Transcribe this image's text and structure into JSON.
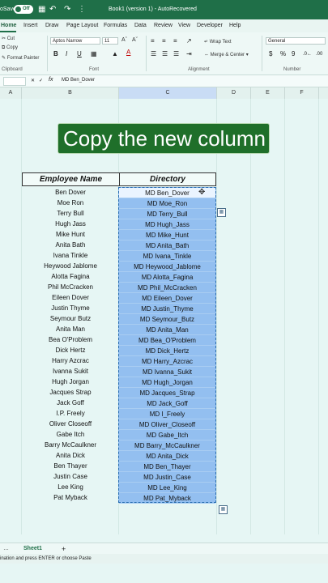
{
  "titlebar": {
    "autosave_prefix": "oSave",
    "toggle_state": "Off",
    "filename": "Book1 (version 1)  -  AutoRecovered",
    "icons": [
      "save-icon",
      "undo-icon",
      "redo-icon",
      "more-icon"
    ]
  },
  "menu": {
    "tabs": [
      "Home",
      "Insert",
      "Draw",
      "Page Layout",
      "Formulas",
      "Data",
      "Review",
      "View",
      "Developer",
      "Help"
    ],
    "active": "Home"
  },
  "ribbon": {
    "clipboard": {
      "cut": "Cut",
      "copy": "Copy",
      "format_painter": "Format Painter",
      "label": "Clipboard"
    },
    "font": {
      "name": "Aptos Narrow",
      "size": "11",
      "bold": "B",
      "italic": "I",
      "underline": "U",
      "label": "Font",
      "font_color": "#c00000"
    },
    "alignment": {
      "wrap_text": "Wrap Text",
      "merge_center": "Merge & Center",
      "label": "Alignment"
    },
    "number": {
      "format": "General",
      "currency": "$",
      "percent": "%",
      "comma": "9",
      "label": "Number"
    }
  },
  "formula_bar": {
    "fx": "fx",
    "content": "MD Ben_Dover"
  },
  "columns": [
    "A",
    "B",
    "C",
    "D",
    "E",
    "F"
  ],
  "banner": {
    "text": "Copy the new column",
    "color": "#1f6f2a"
  },
  "table": {
    "headers": {
      "name": "Employee Name",
      "directory": "Directory"
    },
    "rows": [
      {
        "name": "Ben Dover",
        "directory": "MD Ben_Dover"
      },
      {
        "name": "Moe Ron",
        "directory": "MD Moe_Ron"
      },
      {
        "name": "Terry Bull",
        "directory": "MD Terry_Bull"
      },
      {
        "name": "Hugh Jass",
        "directory": "MD Hugh_Jass"
      },
      {
        "name": "Mike Hunt",
        "directory": "MD Mike_Hunt"
      },
      {
        "name": "Anita Bath",
        "directory": "MD Anita_Bath"
      },
      {
        "name": "Ivana Tinkle",
        "directory": "MD Ivana_Tinkle"
      },
      {
        "name": "Heywood Jablome",
        "directory": "MD Heywood_Jablome"
      },
      {
        "name": "Alotta Fagina",
        "directory": "MD Alotta_Fagina"
      },
      {
        "name": "Phil McCracken",
        "directory": "MD Phil_McCracken"
      },
      {
        "name": "Eileen Dover",
        "directory": "MD Eileen_Dover"
      },
      {
        "name": "Justin Thyme",
        "directory": "MD Justin_Thyme"
      },
      {
        "name": "Seymour Butz",
        "directory": "MD Seymour_Butz"
      },
      {
        "name": "Anita Man",
        "directory": "MD Anita_Man"
      },
      {
        "name": "Bea O'Problem",
        "directory": "MD Bea_O'Problem"
      },
      {
        "name": "Dick Hertz",
        "directory": "MD Dick_Hertz"
      },
      {
        "name": "Harry Azcrac",
        "directory": "MD Harry_Azcrac"
      },
      {
        "name": "Ivanna Sukit",
        "directory": "MD Ivanna_Sukit"
      },
      {
        "name": "Hugh Jorgan",
        "directory": "MD Hugh_Jorgan"
      },
      {
        "name": "Jacques Strap",
        "directory": "MD Jacques_Strap"
      },
      {
        "name": "Jack Goff",
        "directory": "MD Jack_Goff"
      },
      {
        "name": "I.P. Freely",
        "directory": "MD I_Freely"
      },
      {
        "name": "Oliver Closeoff",
        "directory": "MD Oliver_Closeoff"
      },
      {
        "name": "Gabe Itch",
        "directory": "MD Gabe_Itch"
      },
      {
        "name": "Barry McCaulkner",
        "directory": "MD Barry_McCaulkner"
      },
      {
        "name": "Anita Dick",
        "directory": "MD Anita_Dick"
      },
      {
        "name": "Ben Thayer",
        "directory": "MD Ben_Thayer"
      },
      {
        "name": "Justin Case",
        "directory": "MD Justin_Case"
      },
      {
        "name": "Lee King",
        "directory": "MD Lee_King"
      },
      {
        "name": "Pat Myback",
        "directory": "MD Pat_Myback"
      }
    ]
  },
  "sheets": {
    "tabs": [
      "Sheet1"
    ],
    "add": "+"
  },
  "status": {
    "text": "ination and press ENTER or choose Paste"
  }
}
